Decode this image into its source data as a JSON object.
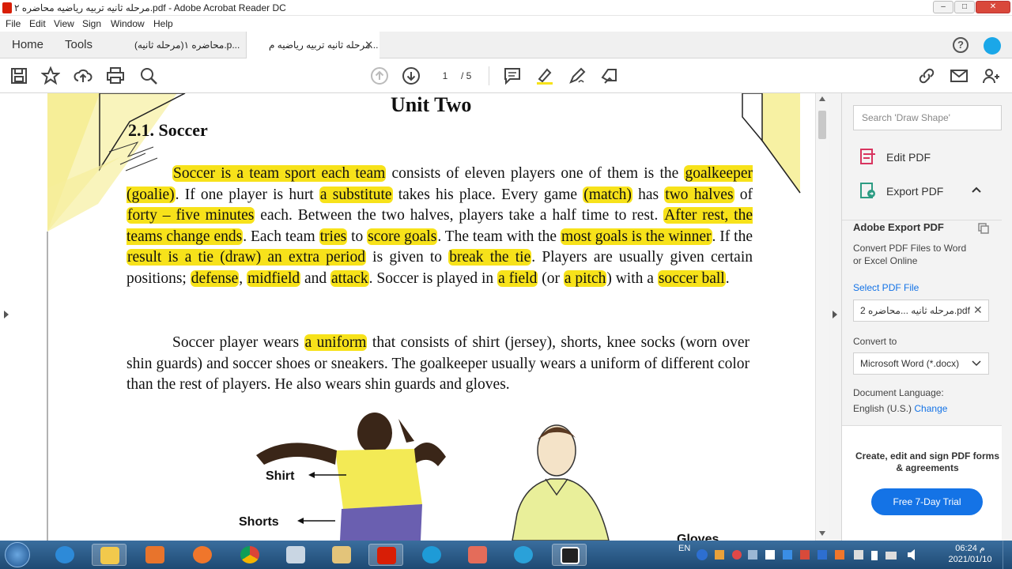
{
  "window": {
    "title": "مرحله ثانیه تربیه ریاضیه محاضره ۲.pdf - Adobe Acrobat Reader DC",
    "min": "–",
    "max": "□",
    "close": "✕"
  },
  "menu": [
    "File",
    "Edit",
    "View",
    "Sign",
    "Window",
    "Help"
  ],
  "tabs": {
    "home": "Home",
    "tools": "Tools",
    "doc1": "محاضره ۱(مرحله ثانیه).p...",
    "doc2": "مرحله ثانیه تربیه ریاضیه م...",
    "close": "✕"
  },
  "toolbar": {
    "page_current": "1",
    "page_total": "/ 5"
  },
  "document": {
    "unit_title": "Unit Two",
    "section_title": "2.1. Soccer",
    "labels": {
      "shirt": "Shirt",
      "shorts": "Shorts",
      "gloves": "Gloves"
    }
  },
  "right_panel": {
    "search_placeholder": "Search 'Draw Shape'",
    "edit_pdf": "Edit PDF",
    "export_pdf": "Export PDF",
    "export_heading": "Adobe Export PDF",
    "export_desc": "Convert PDF Files to Word or Excel Online",
    "select_file": "Select PDF File",
    "selected_file": "مرحله ثانیه ...محاضره 2.pdf",
    "convert_to": "Convert to",
    "convert_value": "Microsoft Word (*.docx)",
    "doc_language": "Document Language:",
    "language_value": "English (U.S.)",
    "change": "Change",
    "promo": "Create, edit and sign PDF forms & agreements",
    "trial": "Free 7-Day Trial"
  },
  "taskbar": {
    "lang": "EN",
    "time": "06:24 م",
    "date": "2021/01/10"
  },
  "colors": {
    "highlight": "#f7e21a",
    "accent": "#1473e6"
  }
}
